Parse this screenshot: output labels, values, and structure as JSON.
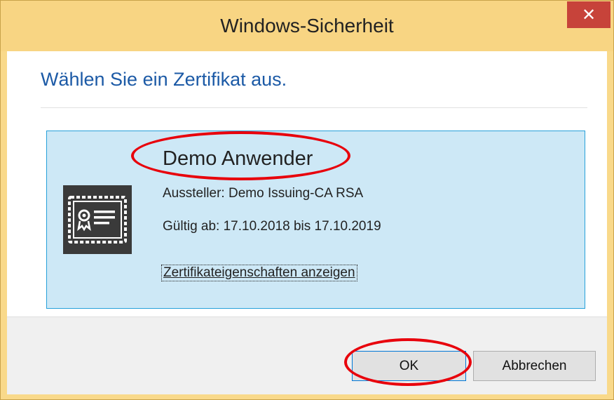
{
  "window": {
    "title": "Windows-Sicherheit",
    "close_glyph": "✕",
    "close_icon": "close-icon",
    "accent_color": "#c7433a"
  },
  "dialog": {
    "heading": "Wählen Sie ein Zertifikat aus.",
    "heading_color": "#1c5aa6"
  },
  "certificate": {
    "name": "Demo Anwender",
    "issuer": "Aussteller: Demo Issuing-CA RSA",
    "validity": "Gültig ab: 17.10.2018 bis 17.10.2019",
    "properties_link": "Zertifikateigenschaften anzeigen",
    "icon": "certificate-icon",
    "selected_bg": "#cde8f6",
    "selected_border": "#26a0da"
  },
  "buttons": {
    "ok": "OK",
    "cancel": "Abbrechen"
  },
  "annotations": {
    "color": "#e8000b",
    "targets": [
      "Demo Anwender",
      "OK"
    ]
  }
}
